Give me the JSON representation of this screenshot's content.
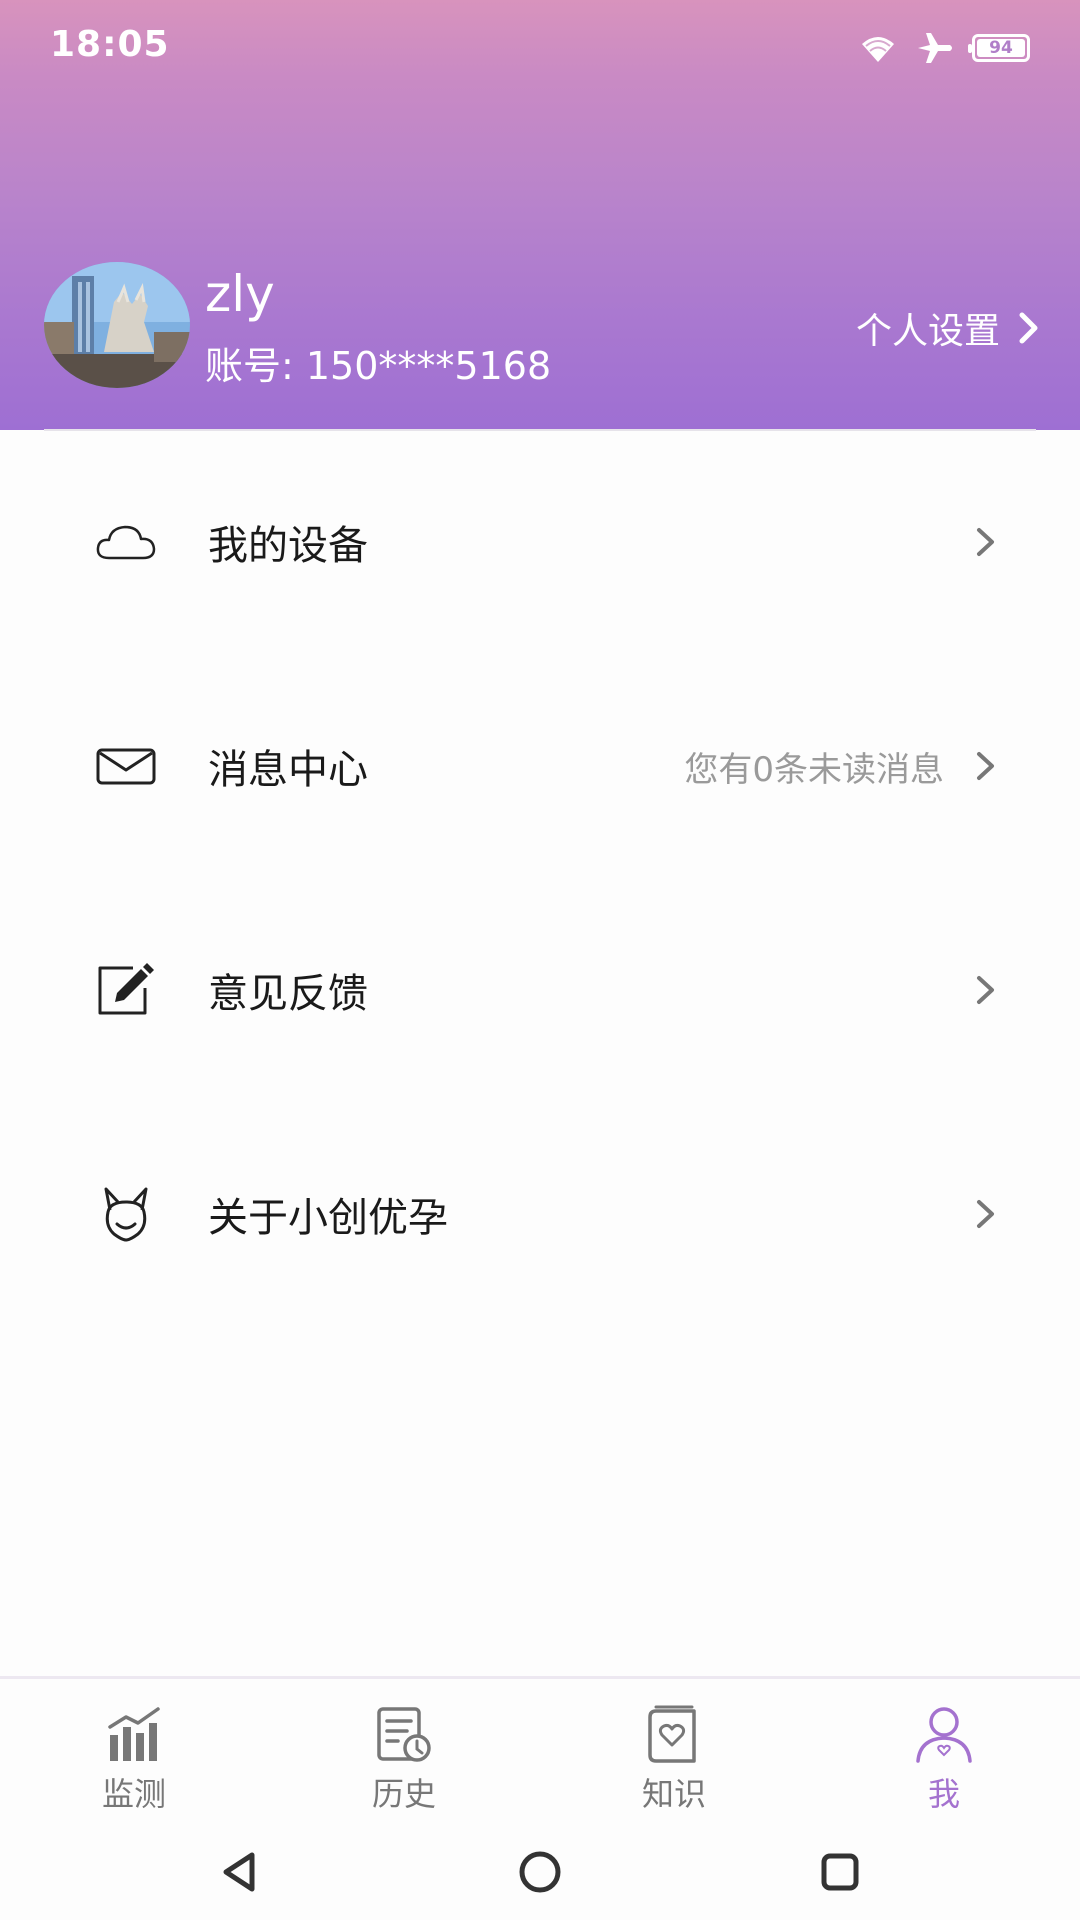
{
  "status_bar": {
    "time": "18:05",
    "battery_level": "94",
    "icons": [
      "wifi-icon",
      "airplane-icon",
      "battery-icon"
    ]
  },
  "profile": {
    "name": "zly",
    "account": "账号: 150****5168",
    "settings_label": "个人设置"
  },
  "menu": {
    "items": [
      {
        "icon": "cloud-icon",
        "label": "我的设备",
        "meta": ""
      },
      {
        "icon": "mail-icon",
        "label": "消息中心",
        "meta": "您有0条未读消息"
      },
      {
        "icon": "edit-icon",
        "label": "意见反馈",
        "meta": ""
      },
      {
        "icon": "rabbit-icon",
        "label": "关于小创优孕",
        "meta": ""
      }
    ]
  },
  "bottom_nav": {
    "tabs": [
      {
        "icon": "chart-icon",
        "label": "监测",
        "active": false
      },
      {
        "icon": "history-icon",
        "label": "历史",
        "active": false
      },
      {
        "icon": "book-icon",
        "label": "知识",
        "active": false
      },
      {
        "icon": "user-icon",
        "label": "我",
        "active": true
      }
    ]
  },
  "colors": {
    "header_gradient_top": "#d893bd",
    "header_gradient_bottom": "#9e6fd3",
    "accent": "#a472cf",
    "muted_text": "#9a9a9a"
  }
}
